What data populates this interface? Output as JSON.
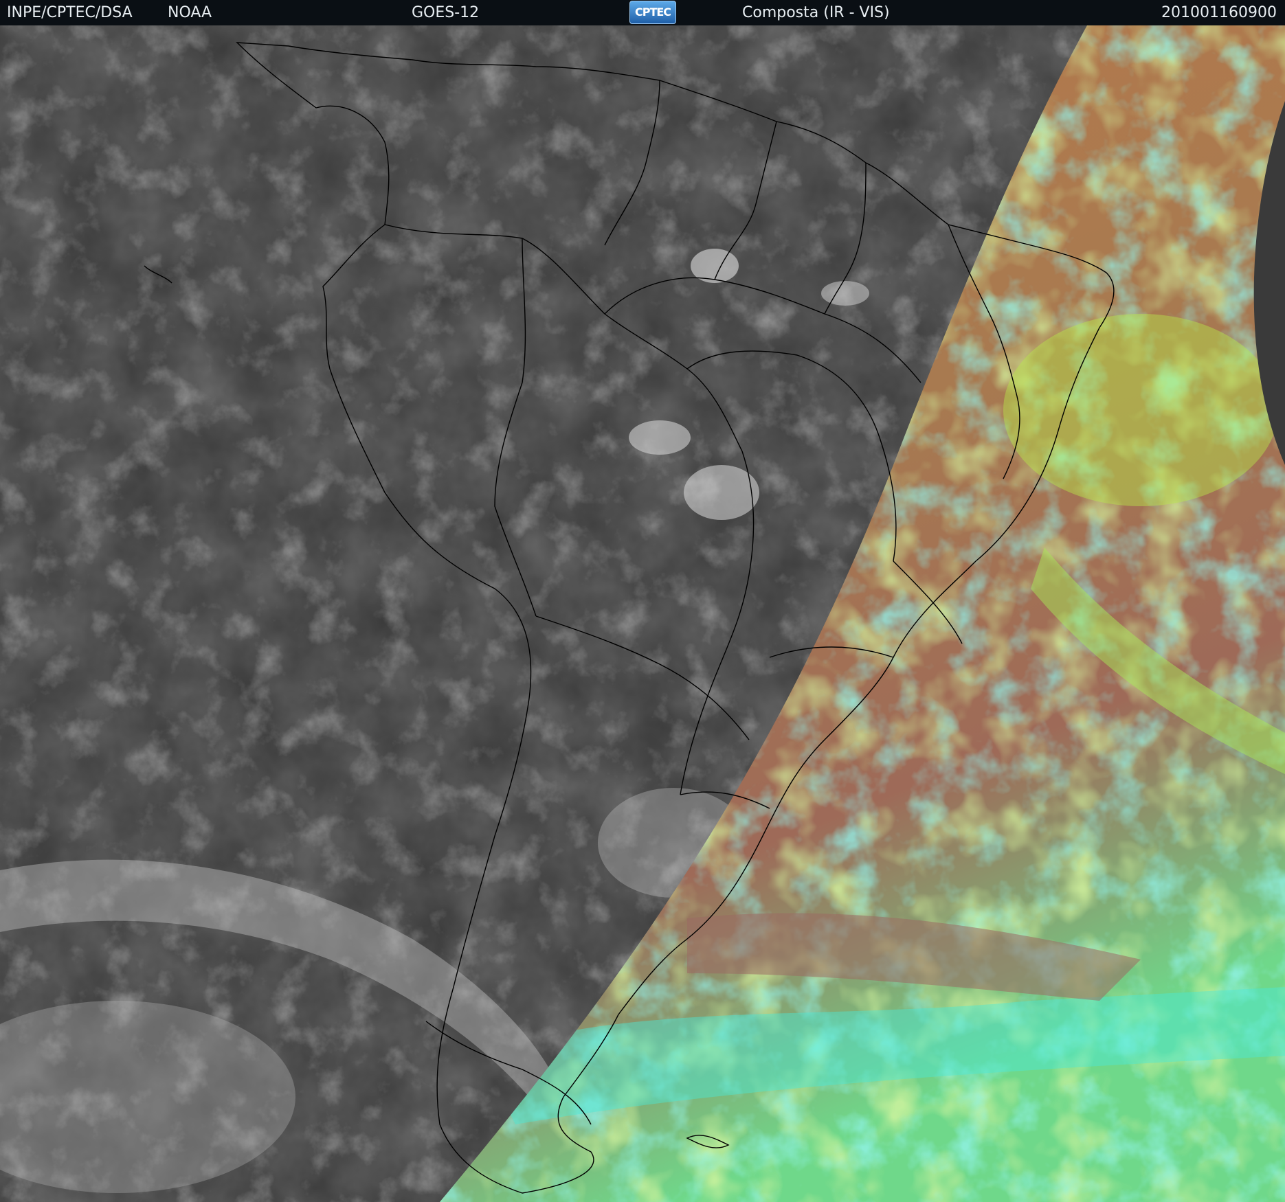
{
  "header": {
    "agency": "INPE/CPTEC/DSA",
    "source": "NOAA",
    "satellite": "GOES-12",
    "logo_text": "CPTEC",
    "product": "Composta (IR - VIS)",
    "timestamp": "201001160900"
  },
  "colors": {
    "header_bg": "#0a0f14",
    "ir_background": "#3a3a3a",
    "cloud_white": "#d8d8d8",
    "vis_orange": "#b8784a",
    "vis_green": "#a8e858",
    "vis_cyan": "#4ae8d8",
    "borders": "#000000"
  }
}
